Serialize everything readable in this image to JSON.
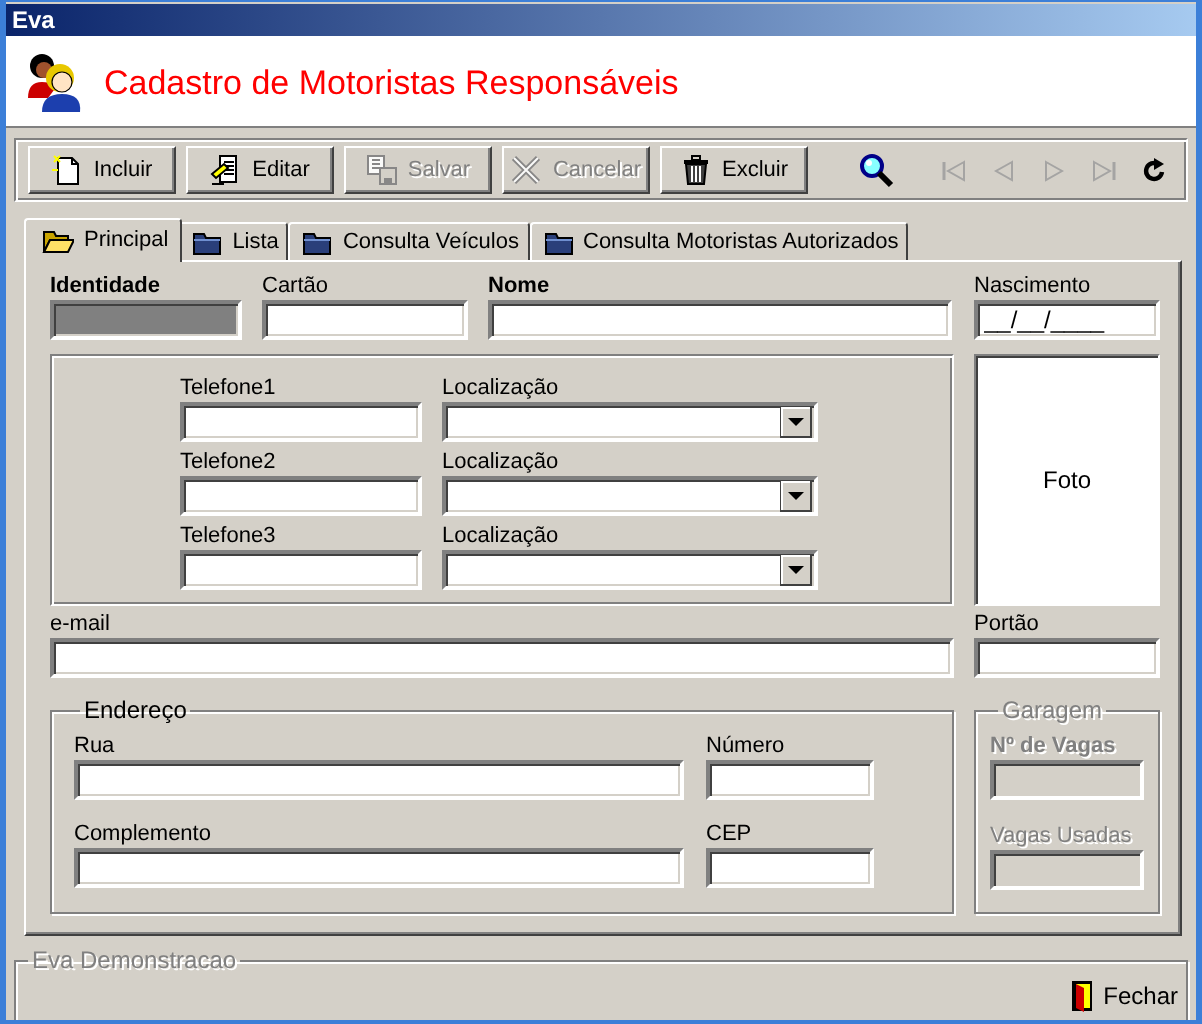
{
  "window": {
    "title": "Eva"
  },
  "header": {
    "title": "Cadastro de Motoristas Responsáveis"
  },
  "toolbar": {
    "buttons": [
      {
        "kind": "add",
        "label": "Incluir",
        "disabled": false
      },
      {
        "kind": "edit",
        "label": "Editar",
        "disabled": false
      },
      {
        "kind": "save",
        "label": "Salvar",
        "disabled": true
      },
      {
        "kind": "cancel",
        "label": "Cancelar",
        "disabled": true
      },
      {
        "kind": "delete",
        "label": "Excluir",
        "disabled": false
      }
    ],
    "navigation": [
      {
        "kind": "search",
        "disabled": false
      },
      {
        "kind": "first",
        "disabled": true
      },
      {
        "kind": "prior",
        "disabled": true
      },
      {
        "kind": "next",
        "disabled": true
      },
      {
        "kind": "last",
        "disabled": true
      },
      {
        "kind": "refresh",
        "disabled": false
      }
    ]
  },
  "tabs": [
    {
      "label": "Principal",
      "selected": true
    },
    {
      "label": "Lista",
      "selected": false
    },
    {
      "label": "Consulta Veículos",
      "selected": false
    },
    {
      "label": "Consulta Motoristas Autorizados",
      "selected": false
    }
  ],
  "form": {
    "top_row": [
      {
        "label": "Identidade",
        "required": true,
        "disabled": true
      },
      {
        "label": "Cartão",
        "required": false,
        "disabled": false
      },
      {
        "label": "Nome",
        "required": true,
        "disabled": false
      }
    ],
    "birth_date": {
      "label": "Nascimento",
      "value": "__/__/____"
    },
    "phones": [
      {
        "label": "Telefone1",
        "location_label": "Localização"
      },
      {
        "label": "Telefone2",
        "location_label": "Localização"
      },
      {
        "label": "Telefone3",
        "location_label": "Localização"
      }
    ],
    "photo": {
      "label": "Foto"
    },
    "email": {
      "label": "e-mail"
    },
    "gate": {
      "label": "Portão"
    },
    "address": {
      "title": "Endereço",
      "fields": [
        {
          "label": "Rua"
        },
        {
          "label": "Número"
        },
        {
          "label": "Complemento"
        },
        {
          "label": "CEP"
        }
      ]
    },
    "garage": {
      "title": "Garagem",
      "disabled": true,
      "fields": [
        {
          "label": "Nº de Vagas",
          "required": true
        },
        {
          "label": "Vagas Usadas",
          "required": false
        }
      ]
    }
  },
  "footer": {
    "title": "Eva Demonstracao",
    "close_button": {
      "label": "Fechar"
    }
  }
}
